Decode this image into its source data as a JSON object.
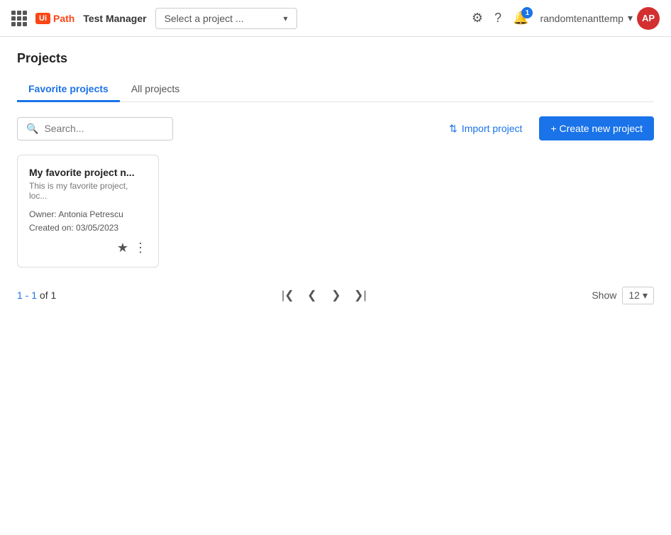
{
  "header": {
    "logo_box": "Ui",
    "logo_path": "Path",
    "app_name": "Test Manager",
    "project_select_placeholder": "Select a project ...",
    "notification_count": "1",
    "user_name": "randomtenanttemp",
    "avatar_initials": "AP"
  },
  "page": {
    "title": "Projects",
    "tabs": [
      {
        "id": "favorite",
        "label": "Favorite projects",
        "active": true
      },
      {
        "id": "all",
        "label": "All projects",
        "active": false
      }
    ],
    "search_placeholder": "Search...",
    "import_label": "Import project",
    "create_label": "+ Create new project",
    "projects": [
      {
        "title": "My favorite project n...",
        "description": "This is my favorite project, loc...",
        "owner": "Owner: Antonia Petrescu",
        "created": "Created on: 03/05/2023"
      }
    ],
    "pagination": {
      "range": "1 - 1",
      "of": "of",
      "total": "1",
      "show_label": "Show",
      "show_value": "12"
    }
  }
}
